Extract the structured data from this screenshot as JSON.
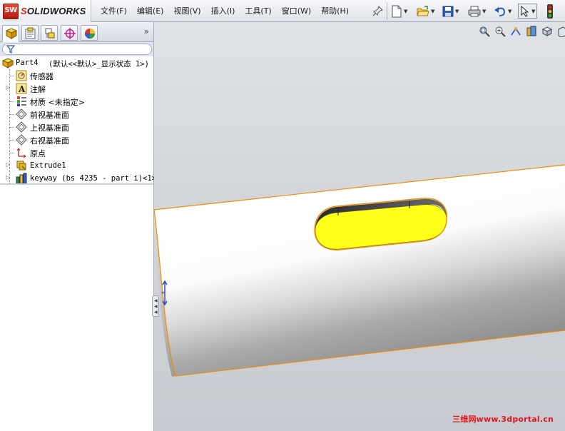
{
  "app": {
    "brand_badge": "SW",
    "brand_prefix": "S",
    "brand_name": "OLIDWORKS"
  },
  "menu": [
    {
      "label": "文件(F)"
    },
    {
      "label": "编辑(E)"
    },
    {
      "label": "视图(V)"
    },
    {
      "label": "插入(I)"
    },
    {
      "label": "工具(T)"
    },
    {
      "label": "窗口(W)"
    },
    {
      "label": "帮助(H)"
    }
  ],
  "toolbar": {
    "icons": [
      "new-document-icon",
      "open-folder-icon",
      "save-icon",
      "print-icon",
      "undo-icon",
      "select-pointer-icon",
      "traffic-light-icon"
    ]
  },
  "panel": {
    "tabs": [
      "feature-manager-icon",
      "property-manager-icon",
      "configuration-manager-icon",
      "dimxpert-icon",
      "display-manager-icon"
    ],
    "collapse_glyph": "»"
  },
  "tree": {
    "root": {
      "name": "Part4",
      "config": "(默认<<默认>_显示状态 1>)"
    },
    "items": [
      {
        "label": "传感器",
        "icon": "sensor-icon",
        "expandable": false
      },
      {
        "label": "注解",
        "icon": "annotation-icon",
        "expandable": true
      },
      {
        "label": "材质 <未指定>",
        "icon": "material-icon",
        "expandable": false
      },
      {
        "label": "前视基准面",
        "icon": "plane-icon",
        "expandable": false
      },
      {
        "label": "上视基准面",
        "icon": "plane-icon",
        "expandable": false
      },
      {
        "label": "右视基准面",
        "icon": "plane-icon",
        "expandable": false
      },
      {
        "label": "原点",
        "icon": "origin-icon",
        "expandable": false
      },
      {
        "label": "Extrude1",
        "icon": "extrude-icon",
        "expandable": true
      },
      {
        "label": "keyway (bs 4235 - part i)<1>",
        "icon": "library-feature-icon",
        "expandable": true
      }
    ]
  },
  "view_tools": [
    "zoom-to-fit-icon",
    "zoom-area-icon",
    "previous-view-icon",
    "section-view-icon",
    "view-orientation-icon",
    "display-style-icon"
  ],
  "colors": {
    "keyway_face": "#ffff1a",
    "edge_highlight": "#f08c00",
    "viewport_bg": "#d2d5da"
  },
  "watermark": "三维网www.3dportal.cn"
}
